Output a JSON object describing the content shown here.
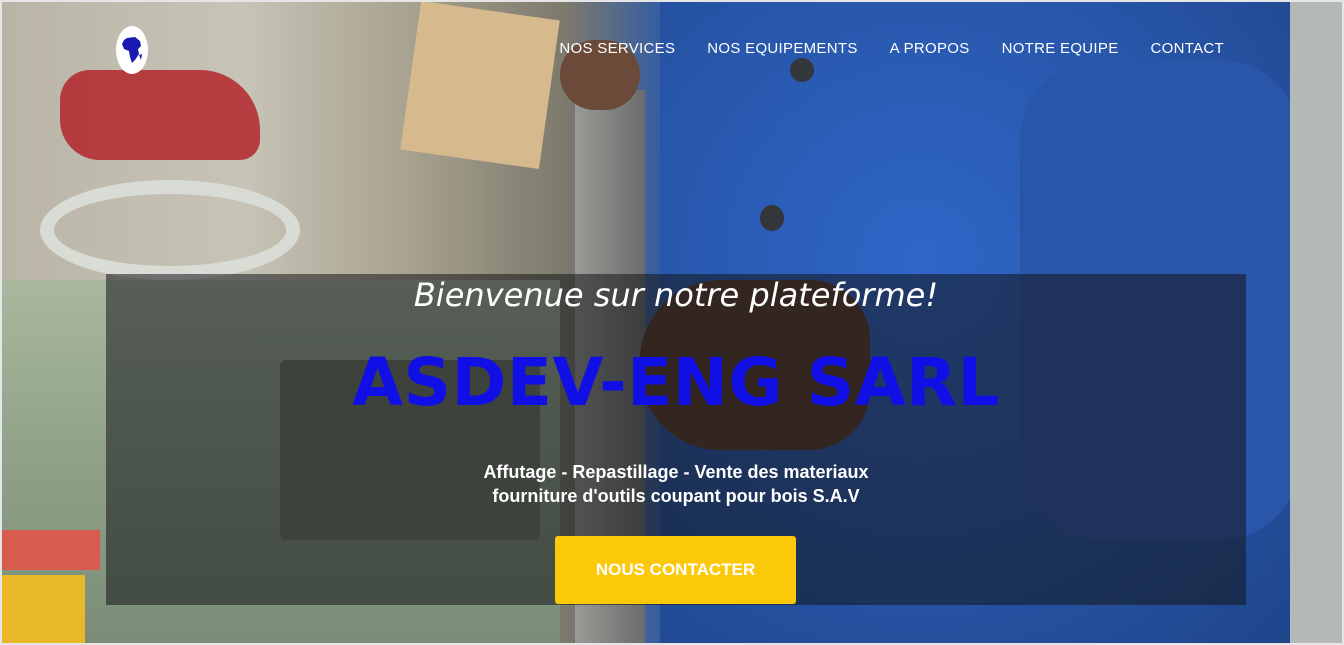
{
  "colors": {
    "brand_text": "#1010e6",
    "cta_background": "#fcc80a",
    "nav_text": "#ffffff",
    "overlay": "rgba(20,22,26,0.55)"
  },
  "header": {
    "logo_icon": "africa-map-logo-icon",
    "nav": [
      {
        "label": "NOS SERVICES"
      },
      {
        "label": "NOS EQUIPEMENTS"
      },
      {
        "label": "A PROPOS"
      },
      {
        "label": "NOTRE EQUIPE"
      },
      {
        "label": "CONTACT"
      }
    ]
  },
  "hero": {
    "welcome": "Bienvenue sur notre plateforme!",
    "brand": "ASDEV-ENG SARL",
    "tagline_line1": "Affutage - Repastillage - Vente des materiaux",
    "tagline_line2": "fourniture d'outils coupant pour bois S.A.V",
    "cta_label": "NOUS CONTACTER"
  }
}
